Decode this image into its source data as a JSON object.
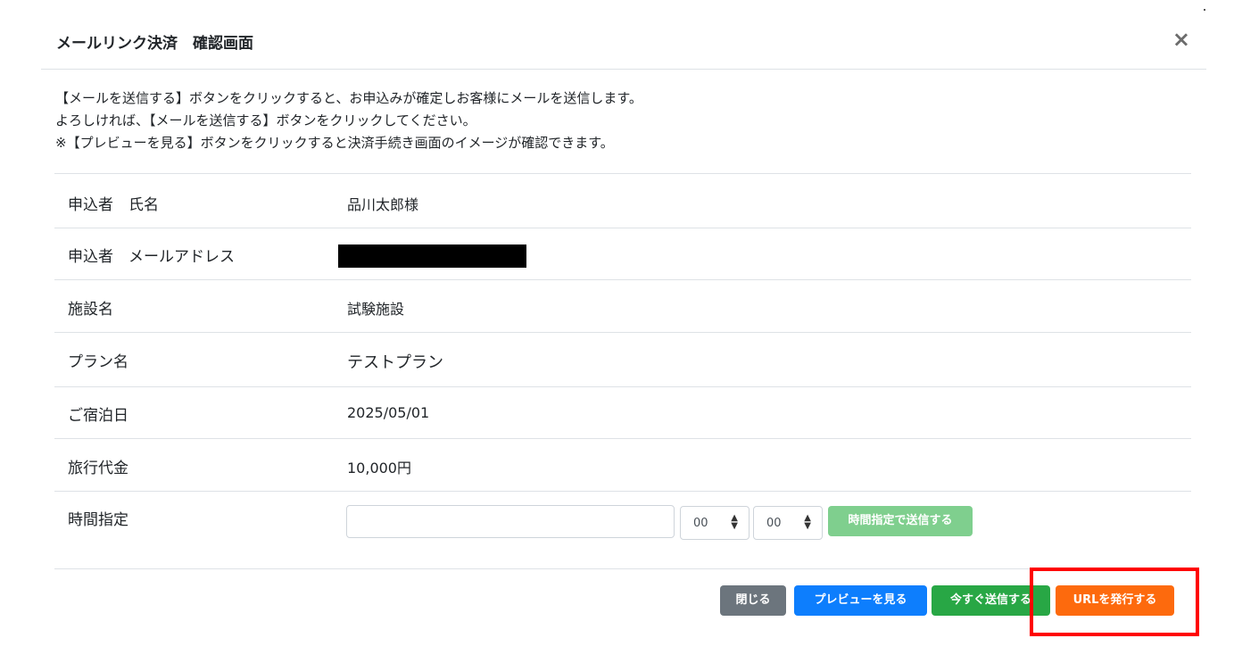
{
  "modal": {
    "title": "メールリンク決済　確認画面",
    "close_label": "×"
  },
  "intro": {
    "line1": "【メールを送信する】ボタンをクリックすると、お申込みが確定しお客様にメールを送信します。",
    "line2": "よろしければ、【メールを送信する】ボタンをクリックしてください。",
    "line3": "※【プレビューを見る】ボタンをクリックすると決済手続き画面のイメージが確認できます。"
  },
  "rows": [
    {
      "label": "申込者　氏名",
      "value": "品川太郎様"
    },
    {
      "label": "申込者　メールアドレス",
      "value": ""
    },
    {
      "label": "施設名",
      "value": "試験施設"
    },
    {
      "label": "プラン名",
      "value": "テストプラン"
    },
    {
      "label": "ご宿泊日",
      "value": "2025/05/01"
    },
    {
      "label": "旅行代金",
      "value": "10,000円"
    },
    {
      "label": "時間指定",
      "value": ""
    }
  ],
  "time": {
    "date_value": "",
    "hour_value": "00",
    "minute_value": "00",
    "send_timed_label": "時間指定で送信する"
  },
  "footer": {
    "close_label": "閉じる",
    "preview_label": "プレビューを見る",
    "send_now_label": "今すぐ送信する",
    "issue_url_label": "URLを発行する"
  },
  "colors": {
    "close_button": "#6c757d",
    "preview_button": "#0d7efd",
    "send_now_button": "#28a745",
    "issue_url_button": "#fd6a0d",
    "timed_send_button": "#7fcf8e",
    "highlight_box": "#ff0000"
  }
}
